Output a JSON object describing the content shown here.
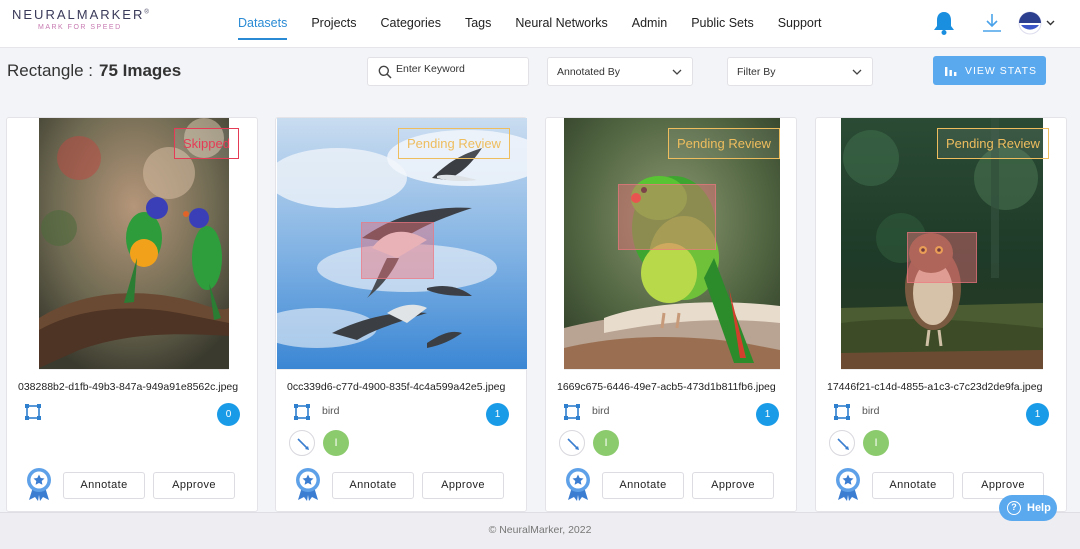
{
  "brand": {
    "name": "NEURALMARKER",
    "trademark": "®",
    "tagline": "MARK FOR SPEED"
  },
  "nav": [
    "Datasets",
    "Projects",
    "Categories",
    "Tags",
    "Neural Networks",
    "Admin",
    "Public Sets",
    "Support"
  ],
  "nav_active": "Datasets",
  "header_icons": [
    "bell-icon",
    "download-icon",
    "user-avatar-icon",
    "chevron-down-icon"
  ],
  "toolbar": {
    "category": "Rectangle :",
    "count": "75 Images",
    "search_placeholder": "Enter Keyword",
    "annotated_by": "Annotated By",
    "filter_by": "Filter By",
    "view_stats": "VIEW STATS"
  },
  "cards": [
    {
      "status": "Skipped",
      "status_type": "skipped",
      "filename": "038288b2-d1fb-49b3-847a-949a91e8562c.jpeg",
      "label": "",
      "count": "0",
      "annotator": "",
      "annotate_label": "Annotate",
      "approve_label": "Approve"
    },
    {
      "status": "Pending Review",
      "status_type": "pending",
      "filename": "0cc339d6-c77d-4900-835f-4c4a599a42e5.jpeg",
      "label": "bird",
      "count": "1",
      "annotator": "I",
      "annotate_label": "Annotate",
      "approve_label": "Approve"
    },
    {
      "status": "Pending Review",
      "status_type": "pending",
      "filename": "1669c675-6446-49e7-acb5-473d1b811fb6.jpeg",
      "label": "bird",
      "count": "1",
      "annotator": "I",
      "annotate_label": "Annotate",
      "approve_label": "Approve"
    },
    {
      "status": "Pending Review",
      "status_type": "pending",
      "filename": "17446f21-c14d-4855-a1c3-c7c23d2de9fa.jpeg",
      "label": "bird",
      "count": "1",
      "annotator": "I",
      "annotate_label": "Annotate",
      "approve_label": "Approve"
    }
  ],
  "footer": "© NeuralMarker, 2022",
  "help_label": "Help",
  "colors": {
    "accent": "#2a8bd4",
    "button": "#5aa9ef",
    "skipped": "#e53b56",
    "pending": "#eebd5e",
    "count": "#1a9be8",
    "annotator": "#8cca6e"
  }
}
